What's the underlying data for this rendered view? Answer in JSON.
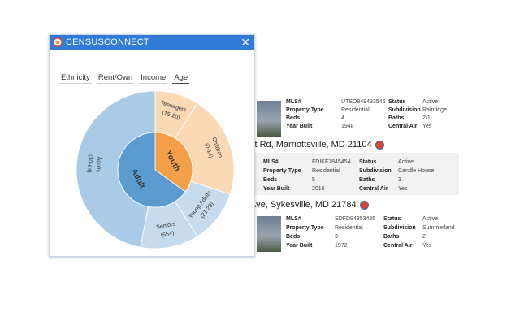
{
  "popup": {
    "title": "CENSUSCONNECT",
    "close_label": "✕",
    "tabs": [
      {
        "label": "Ethnicity",
        "active": false
      },
      {
        "label": "Rent/Own",
        "active": false
      },
      {
        "label": "Income",
        "active": false
      },
      {
        "label": "Age",
        "active": true
      }
    ]
  },
  "chart_data": {
    "type": "pie",
    "inner": [
      {
        "label": "Youth",
        "value": 35,
        "color": "#f4a04a"
      },
      {
        "label": "Adult",
        "value": 65,
        "color": "#5a9bd0"
      }
    ],
    "outer": [
      {
        "label": "Teenagers",
        "range": "(15-20)",
        "value": 9,
        "color": "#fbd9b5"
      },
      {
        "label": "Children",
        "range": "(0-14)",
        "value": 21,
        "color": "#fbd9b5"
      },
      {
        "label": "Young Adults",
        "range": "(21-29)",
        "value": 11,
        "color": "#c6dcee"
      },
      {
        "label": "Seniors",
        "range": "(65+)",
        "value": 12,
        "color": "#c6dcee"
      },
      {
        "label": "Adults",
        "range": "(30-64)",
        "value": 47,
        "color": "#a9cbe8"
      }
    ]
  },
  "listings": [
    {
      "address": "",
      "fields": [
        {
          "k": "MLS#",
          "v": "UTSO849433546"
        },
        {
          "k": "Property Type",
          "v": "Residential"
        },
        {
          "k": "Beds",
          "v": "4"
        },
        {
          "k": "Year Built",
          "v": "1948"
        },
        {
          "k": "Status",
          "v": "Active"
        },
        {
          "k": "Subdivision",
          "v": "Rainridge"
        },
        {
          "k": "Baths",
          "v": "2/1"
        },
        {
          "k": "Central Air",
          "v": "Yes"
        }
      ]
    },
    {
      "address": "st Rd, Marriottsville, MD 21104",
      "fields": [
        {
          "k": "MLS#",
          "v": "FDIKF7845454"
        },
        {
          "k": "Property Type",
          "v": "Residential"
        },
        {
          "k": "Beds",
          "v": "5"
        },
        {
          "k": "Year Built",
          "v": "2016"
        },
        {
          "k": "Status",
          "v": "Active"
        },
        {
          "k": "Subdivision",
          "v": "Candle House"
        },
        {
          "k": "Baths",
          "v": "3"
        },
        {
          "k": "Central Air",
          "v": "Yes"
        }
      ]
    },
    {
      "address": "Ave, Sykesville, MD 21784",
      "fields": [
        {
          "k": "MLS#",
          "v": "SDFD94353485"
        },
        {
          "k": "Property Type",
          "v": "Residential"
        },
        {
          "k": "Beds",
          "v": "3"
        },
        {
          "k": "Year Built",
          "v": "1972"
        },
        {
          "k": "Status",
          "v": "Active"
        },
        {
          "k": "Subdivision",
          "v": "Summerland"
        },
        {
          "k": "Baths",
          "v": "2"
        },
        {
          "k": "Central Air",
          "v": "Yes"
        }
      ]
    }
  ]
}
